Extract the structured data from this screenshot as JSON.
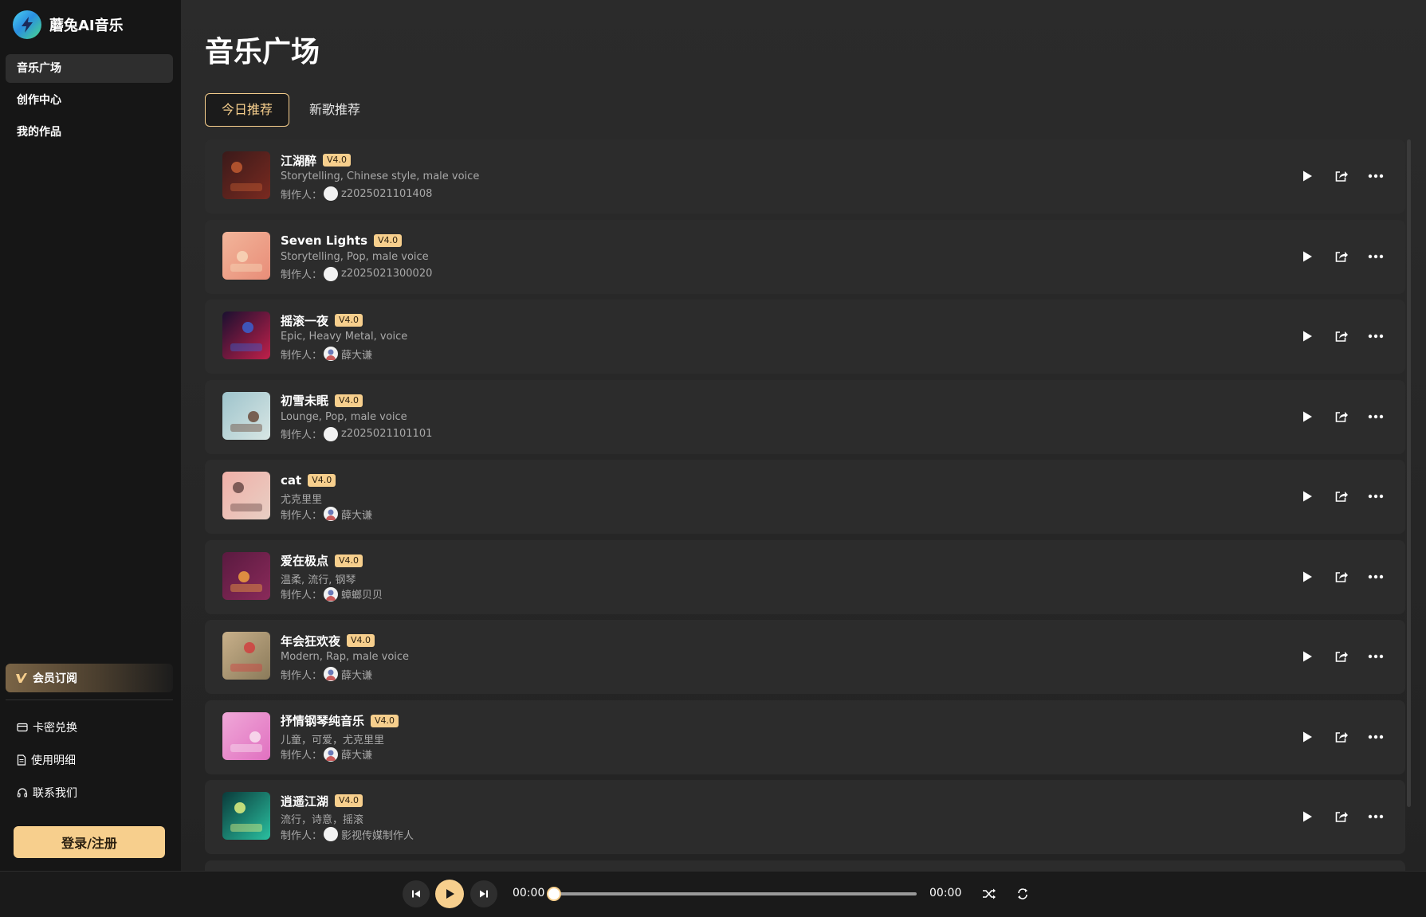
{
  "app": {
    "name": "蘑兔AI音乐"
  },
  "sidebar": {
    "nav": [
      {
        "label": "音乐广场",
        "active": true
      },
      {
        "label": "创作中心",
        "active": false
      },
      {
        "label": "我的作品",
        "active": false
      }
    ],
    "member_label": "会员订阅",
    "links": [
      {
        "label": "卡密兑换",
        "icon": "card-icon"
      },
      {
        "label": "使用明细",
        "icon": "document-icon"
      },
      {
        "label": "联系我们",
        "icon": "headset-icon"
      }
    ],
    "login_label": "登录/注册"
  },
  "main": {
    "title": "音乐广场",
    "tabs": [
      {
        "label": "今日推荐",
        "active": true
      },
      {
        "label": "新歌推荐",
        "active": false
      }
    ],
    "maker_prefix": "制作人：",
    "songs": [
      {
        "title": "江湖醉",
        "version": "V4.0",
        "desc": "Storytelling, Chinese style, male voice",
        "maker": "z2025021101408",
        "cover_colors": [
          "#3a1a1a",
          "#7a2a20",
          "#c05a30"
        ]
      },
      {
        "title": "Seven Lights",
        "version": "V4.0",
        "desc": "Storytelling, Pop, male voice",
        "maker": "z2025021300020",
        "cover_colors": [
          "#f2b59a",
          "#e88d78",
          "#f7d6b8"
        ]
      },
      {
        "title": "摇滚一夜",
        "version": "V4.0",
        "desc": "Epic, Heavy Metal, voice",
        "maker": "薛大谦",
        "cover_colors": [
          "#1a1030",
          "#c0204a",
          "#3a60d0"
        ]
      },
      {
        "title": "初雪未眠",
        "version": "V4.0",
        "desc": "Lounge, Pop, male voice",
        "maker": "z2025021101101",
        "cover_colors": [
          "#9ec4cc",
          "#d8e6e4",
          "#6a4a3a"
        ]
      },
      {
        "title": "cat",
        "version": "V4.0",
        "desc": "尤克里里",
        "maker": "薛大谦",
        "cover_colors": [
          "#f0b0a8",
          "#e8cfc4",
          "#6a4a48"
        ]
      },
      {
        "title": "爱在极点",
        "version": "V4.0",
        "desc": "温柔, 流行, 钢琴",
        "maker": "蟑螂贝贝",
        "cover_colors": [
          "#5a1a40",
          "#8a2a5a",
          "#f0a040"
        ]
      },
      {
        "title": "年会狂欢夜",
        "version": "V4.0",
        "desc": "Modern, Rap, male voice",
        "maker": "薛大谦",
        "cover_colors": [
          "#c8b08a",
          "#8a7a5a",
          "#d04040"
        ]
      },
      {
        "title": "抒情钢琴纯音乐",
        "version": "V4.0",
        "desc": "儿童，可爱，尤克里里",
        "maker": "薛大谦",
        "cover_colors": [
          "#f0a8d8",
          "#e070c0",
          "#f8e0f0"
        ]
      },
      {
        "title": "逍遥江湖",
        "version": "V4.0",
        "desc": "流行，诗意，摇滚",
        "maker": "影视传媒制作人",
        "cover_colors": [
          "#0a3a3a",
          "#2ac0a0",
          "#e0f080"
        ]
      }
    ]
  },
  "player": {
    "current_time": "00:00",
    "total_time": "00:00",
    "progress": 0
  },
  "colors": {
    "accent": "#f7cf8d",
    "background": "#222222",
    "sidebar": "#161616",
    "row": "#2c2c2c"
  }
}
